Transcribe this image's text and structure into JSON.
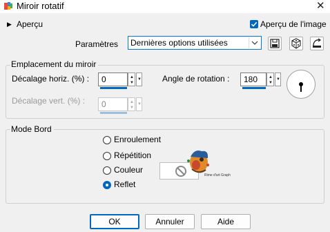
{
  "window": {
    "title": "Miroir rotatif"
  },
  "toolbar": {
    "preview_label": "Aperçu",
    "image_preview_label": "Aperçu de l'image",
    "image_preview_checked": true,
    "params_label": "Paramètres",
    "params_value": "Dernières options utilisées"
  },
  "mirror_position": {
    "title": "Emplacement du miroir",
    "horiz_label": "Décalage horiz. (%) :",
    "horiz_value": "0",
    "vert_label": "Décalage vert. (%) :",
    "vert_value": "0",
    "angle_label": "Angle de rotation :",
    "angle_value": "180"
  },
  "edge_mode": {
    "title": "Mode Bord",
    "options": [
      "Enroulement",
      "Répétition",
      "Couleur",
      "Reflet"
    ],
    "selected": "Reflet",
    "watermark_text": "Rime d'art Graph"
  },
  "buttons": {
    "ok": "OK",
    "cancel": "Annuler",
    "help": "Aide"
  },
  "colors": {
    "accent": "#0067c0",
    "background": "#f0f0f0"
  }
}
